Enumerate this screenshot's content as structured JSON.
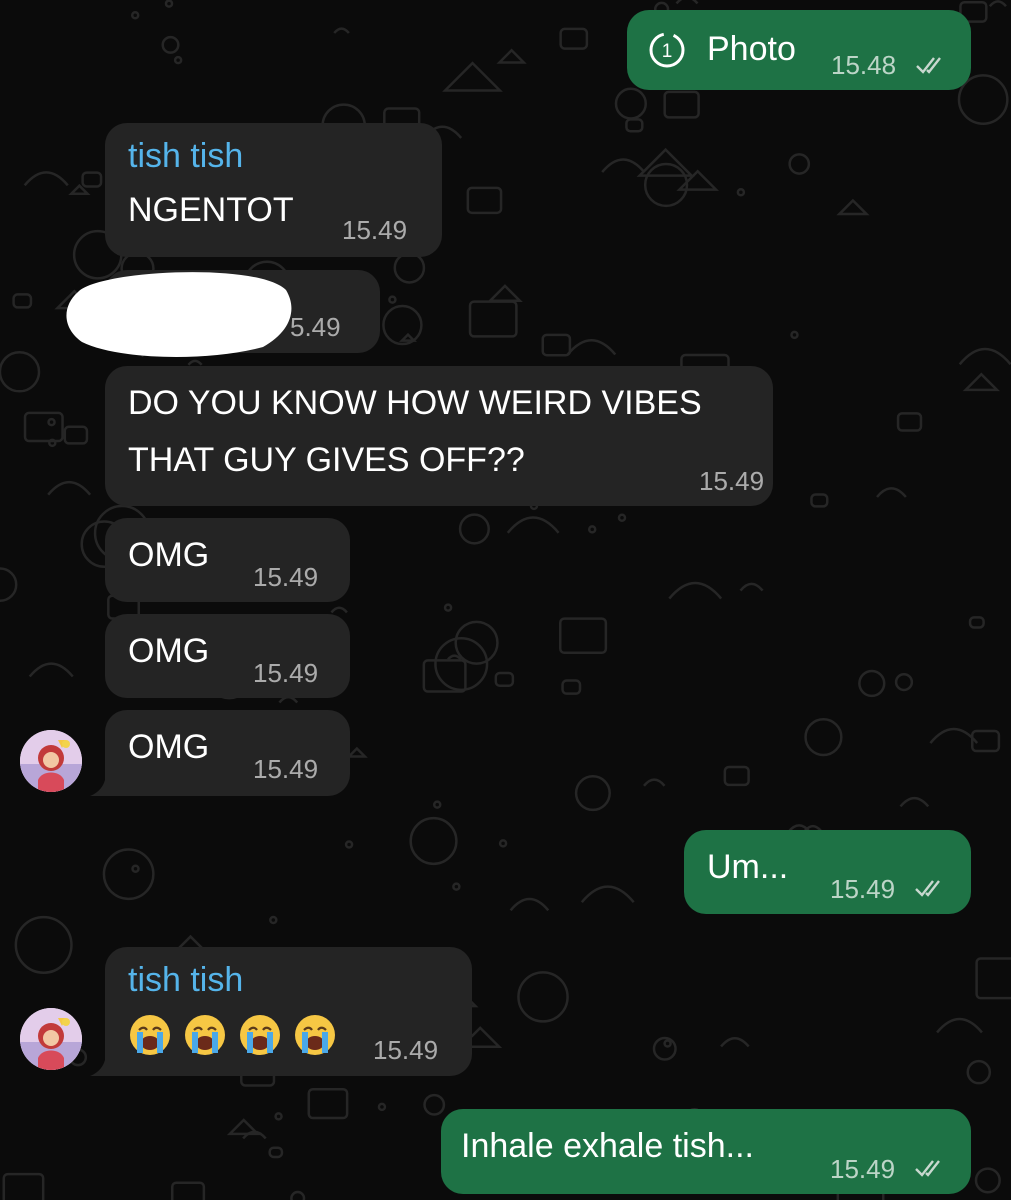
{
  "messages": [
    {
      "id": "m1",
      "direction": "outgoing",
      "type": "photo",
      "icon": "view-once-icon",
      "view_once_count": "1",
      "text": "Photo",
      "time": "15.48",
      "status": "read"
    },
    {
      "id": "m2",
      "direction": "incoming",
      "sender": "tish tish",
      "text": "NGENTOT",
      "time": "15.49"
    },
    {
      "id": "m3",
      "direction": "incoming",
      "text": "",
      "redacted": true,
      "time": "15.49",
      "time_visible": "5.49"
    },
    {
      "id": "m4",
      "direction": "incoming",
      "text_lines": [
        "DO YOU KNOW HOW WEIRD VIBES",
        "THAT GUY GIVES OFF??"
      ],
      "time": "15.49"
    },
    {
      "id": "m5",
      "direction": "incoming",
      "text": "OMG",
      "time": "15.49"
    },
    {
      "id": "m6",
      "direction": "incoming",
      "text": "OMG",
      "time": "15.49"
    },
    {
      "id": "m7",
      "direction": "incoming",
      "text": "OMG",
      "time": "15.49",
      "avatar": true
    },
    {
      "id": "m8",
      "direction": "outgoing",
      "text": "Um...",
      "time": "15.49",
      "status": "read"
    },
    {
      "id": "m9",
      "direction": "incoming",
      "sender": "tish tish",
      "emoji": [
        "loudly-crying-face",
        "loudly-crying-face",
        "loudly-crying-face",
        "loudly-crying-face"
      ],
      "time": "15.49",
      "avatar": true
    },
    {
      "id": "m10",
      "direction": "outgoing",
      "text": "Inhale exhale tish...",
      "time": "15.49",
      "status": "read"
    }
  ],
  "colors": {
    "background": "#0b0b0b",
    "incoming_bubble": "#242424",
    "outgoing_bubble": "#1e7245",
    "sender_name": "#55b4ea",
    "read_ticks": "#c8d8cf"
  }
}
